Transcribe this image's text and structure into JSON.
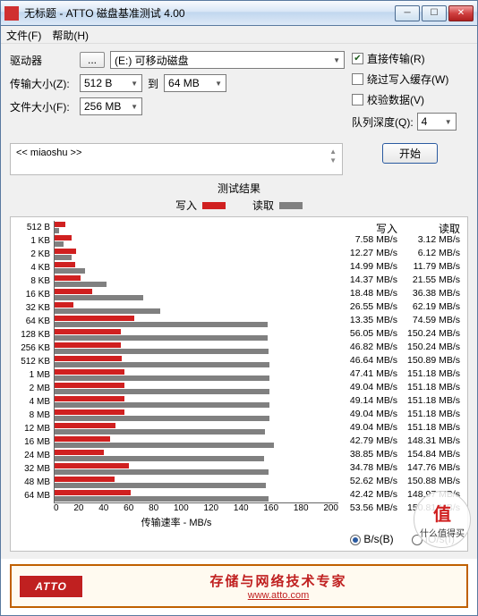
{
  "window": {
    "title": "无标题 - ATTO 磁盘基准测试 4.00"
  },
  "menu": {
    "file": "文件(F)",
    "help": "帮助(H)"
  },
  "form": {
    "drive_label": "驱动器",
    "browse": "...",
    "drive_value": "(E:) 可移动磁盘",
    "transfer_size_label": "传输大小(Z):",
    "transfer_from": "512 B",
    "to": "到",
    "transfer_to": "64 MB",
    "file_size_label": "文件大小(F):",
    "file_size": "256 MB"
  },
  "checks": {
    "direct": {
      "label": "直接传输(R)",
      "checked": true
    },
    "bypass": {
      "label": "绕过写入缓存(W)",
      "checked": false
    },
    "verify": {
      "label": "校验数据(V)",
      "checked": false
    },
    "queue_label": "队列深度(Q):",
    "queue_value": "4"
  },
  "desc": "<< miaoshu >>",
  "start": "开始",
  "results_title": "测试结果",
  "legend": {
    "write": "写入",
    "read": "读取"
  },
  "xlabel": "传输速率 - MB/s",
  "xticks": [
    "0",
    "20",
    "40",
    "60",
    "80",
    "100",
    "120",
    "140",
    "160",
    "180",
    "200"
  ],
  "numhdr": {
    "write": "写入",
    "read": "读取"
  },
  "radios": {
    "bs": "B/s(B)",
    "ios": "IO/s(I)"
  },
  "footer": {
    "logo": "ATTO",
    "line1": "存储与网络技术专家",
    "url": "www.atto.com"
  },
  "badge": {
    "top": "值",
    "bottom": "什么值得买"
  },
  "chart_data": {
    "type": "bar",
    "title": "测试结果",
    "xlabel": "传输速率 - MB/s",
    "ylabel": "",
    "xlim": [
      0,
      200
    ],
    "categories": [
      "512 B",
      "1 KB",
      "2 KB",
      "4 KB",
      "8 KB",
      "16 KB",
      "32 KB",
      "64 KB",
      "128 KB",
      "256 KB",
      "512 KB",
      "1 MB",
      "2 MB",
      "4 MB",
      "8 MB",
      "12 MB",
      "16 MB",
      "24 MB",
      "32 MB",
      "48 MB",
      "64 MB"
    ],
    "series": [
      {
        "name": "写入",
        "unit": "MB/s",
        "values": [
          7.58,
          12.27,
          14.99,
          14.37,
          18.48,
          26.55,
          13.35,
          56.05,
          46.82,
          46.64,
          47.41,
          49.04,
          49.14,
          49.04,
          49.04,
          42.79,
          38.85,
          34.78,
          52.62,
          42.42,
          53.56
        ]
      },
      {
        "name": "读取",
        "unit": "MB/s",
        "values": [
          3.12,
          6.12,
          11.79,
          21.55,
          36.38,
          62.19,
          74.59,
          150.24,
          150.24,
          150.89,
          151.18,
          151.18,
          151.18,
          151.18,
          151.18,
          148.31,
          154.84,
          147.76,
          150.88,
          148.97,
          150.81
        ]
      }
    ]
  }
}
